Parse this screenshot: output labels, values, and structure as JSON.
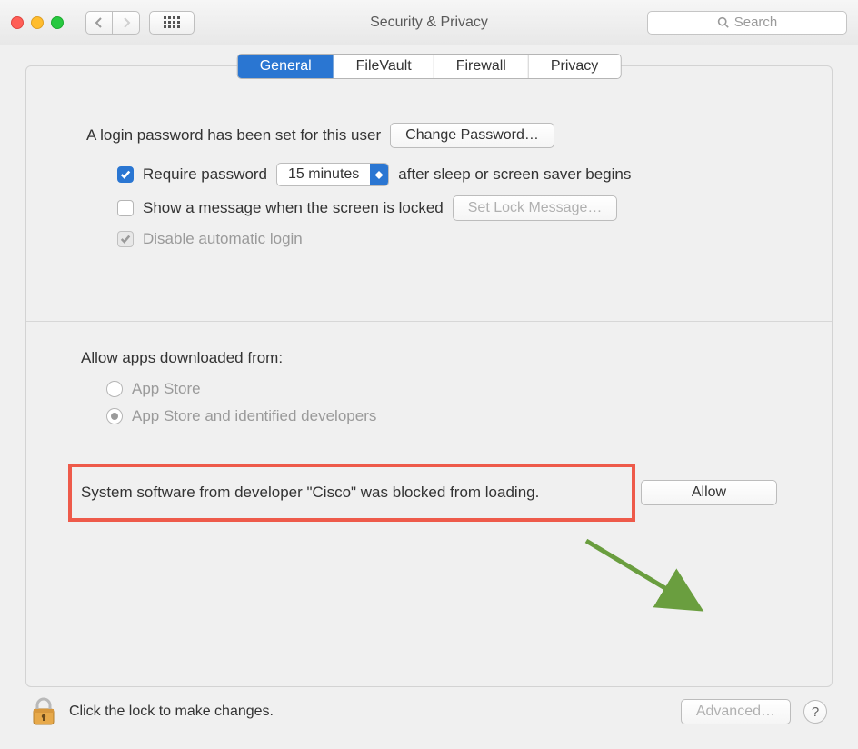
{
  "window": {
    "title": "Security & Privacy",
    "search_placeholder": "Search"
  },
  "tabs": [
    {
      "label": "General",
      "selected": true
    },
    {
      "label": "FileVault",
      "selected": false
    },
    {
      "label": "Firewall",
      "selected": false
    },
    {
      "label": "Privacy",
      "selected": false
    }
  ],
  "login": {
    "password_set_text": "A login password has been set for this user",
    "change_password_label": "Change Password…",
    "require_password_label": "Require password",
    "require_password_checked": true,
    "delay_value": "15 minutes",
    "after_text": "after sleep or screen saver begins",
    "show_message_label": "Show a message when the screen is locked",
    "show_message_checked": false,
    "set_lock_message_label": "Set Lock Message…",
    "disable_auto_login_label": "Disable automatic login",
    "disable_auto_login_checked": true
  },
  "apps": {
    "section_label": "Allow apps downloaded from:",
    "options": [
      {
        "label": "App Store",
        "selected": false
      },
      {
        "label": "App Store and identified developers",
        "selected": true
      }
    ],
    "blocked_text": "System software from developer \"Cisco\" was blocked from loading.",
    "allow_label": "Allow"
  },
  "footer": {
    "lock_text": "Click the lock to make changes.",
    "advanced_label": "Advanced…"
  }
}
